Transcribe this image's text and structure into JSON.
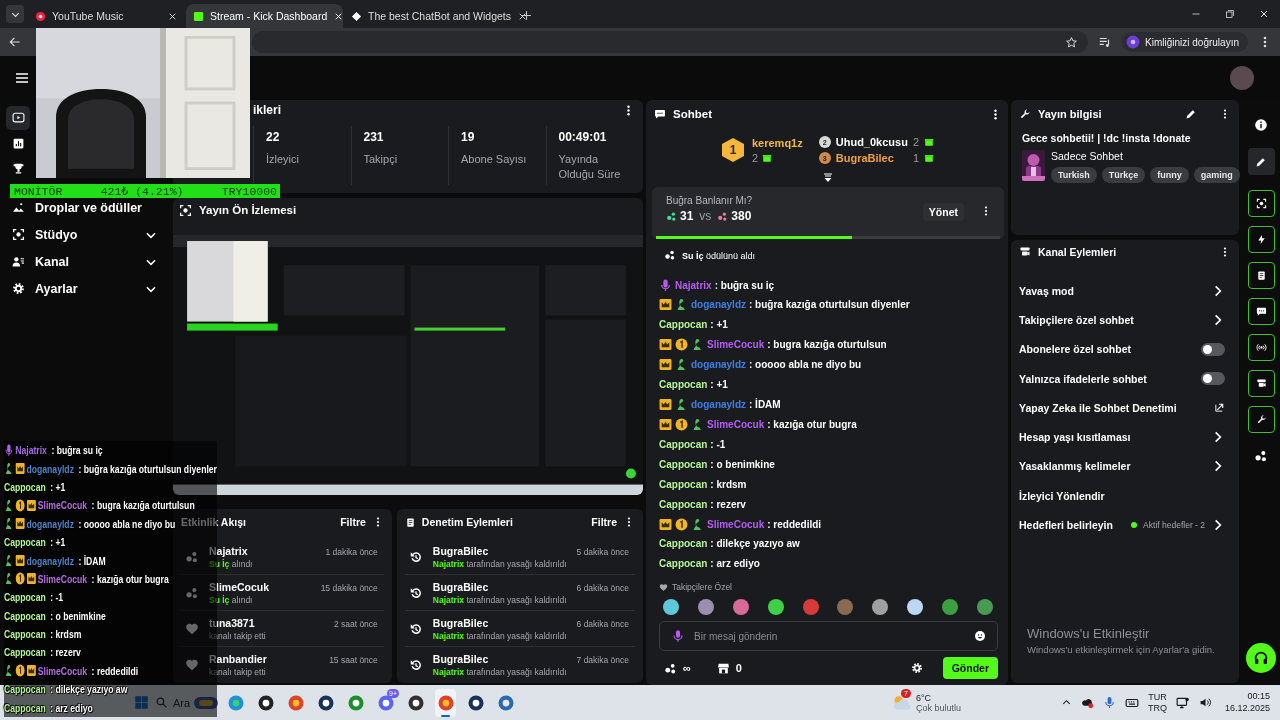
{
  "browser": {
    "tabs": [
      {
        "title": "YouTube Music",
        "selected": false
      },
      {
        "title": "Stream - Kick Dashboard",
        "selected": true
      },
      {
        "title": "The best ChatBot and Widgets",
        "selected": false
      }
    ],
    "verify": "Kimliğinizi doğrulayın"
  },
  "sidebar": {
    "icon_items": [
      {
        "selected": true
      },
      {
        "selected": false
      },
      {
        "selected": false
      }
    ],
    "items": [
      {
        "label": "Droplar ve ödüller",
        "expandable": false
      },
      {
        "label": "Stüdyo",
        "expandable": true
      },
      {
        "label": "Kanal",
        "expandable": true
      },
      {
        "label": "Ayarlar",
        "expandable": true
      }
    ]
  },
  "stats": {
    "title": "ikleri",
    "items": [
      {
        "value": "22",
        "label": "İzleyici"
      },
      {
        "value": "231",
        "label": "Takipçi"
      },
      {
        "value": "19",
        "label": "Abone Sayısı"
      },
      {
        "value": "00:49:01",
        "label": "Yayında Olduğu Süre"
      }
    ]
  },
  "preview": {
    "title": "Yayın Ön İzlemesi"
  },
  "ticker": {
    "label": "MONİTÖR",
    "change": "421₺ (4.21%)",
    "target": "TRY10000"
  },
  "events": {
    "title": "Etkinlik Akışı",
    "filter": "Filtre",
    "items": [
      {
        "kind": "reward",
        "user": "Najatrix",
        "highlight": "Su İç",
        "detail": "alındı",
        "time": "1 dakika önce"
      },
      {
        "kind": "reward",
        "user": "SlimeCocuk",
        "highlight": "Su İç",
        "detail": "alındı",
        "time": "15 dakika önce"
      },
      {
        "kind": "follow",
        "user": "tuna3871",
        "detail": "kanalı takip etti",
        "time": "2 saat önce"
      },
      {
        "kind": "follow",
        "user": "Ranbandier",
        "detail": "kanalı takip etti",
        "time": "15 saat önce"
      }
    ]
  },
  "moderation": {
    "title": "Denetim Eylemleri",
    "filter": "Filtre",
    "items": [
      {
        "kind": "unban",
        "user": "BugraBilec",
        "highlight": "Najatrix",
        "detail": "tarafından yasağı kaldırıldı",
        "time": "5 dakika önce"
      },
      {
        "kind": "unban",
        "user": "BugraBilec",
        "highlight": "Najatrix",
        "detail": "tarafından yasağı kaldırıldı",
        "time": "6 dakika önce"
      },
      {
        "kind": "unban",
        "user": "BugraBilec",
        "highlight": "Najatrix",
        "detail": "tarafından yasağı kaldırıldı",
        "time": "6 dakika önce"
      },
      {
        "kind": "unban",
        "user": "BugraBilec",
        "highlight": "Najatrix",
        "detail": "tarafından yasağı kaldırıldı",
        "time": "7 dakika önce"
      }
    ]
  },
  "chat": {
    "title": "Sohbet",
    "leaders": [
      {
        "rank": "1",
        "name": "keremq1z",
        "gifts": "2",
        "color": "#f5b83d"
      },
      {
        "rank": "2",
        "name": "Uhud_0kcusu",
        "gifts": "2",
        "color": "#ffffff"
      },
      {
        "rank": "3",
        "name": "BugraBilec",
        "gifts": "1",
        "color": "#f0a045"
      }
    ],
    "poll": {
      "question": "Buğra Banlanır Mı?",
      "votes_a": "31",
      "vs": "vs",
      "votes_b": "380",
      "manage": "Yönet",
      "level": 0.57
    },
    "pinned": "**Su İç** ödülünü aldı",
    "messages": [
      {
        "kind": "mic",
        "user": "Najatrix",
        "color": "#b65cf5",
        "text": ": buğra su iç"
      },
      {
        "kind": "crown",
        "user": "doganayldz",
        "color": "#3f7fe0",
        "text": ": buğra kazığa oturtulsun diyenler"
      },
      {
        "kind": "plain",
        "user": "Cappocan",
        "color": "#b4f59a",
        "text": ": +1"
      },
      {
        "kind": "gifter",
        "user": "SlimeCocuk",
        "color": "#b65cf5",
        "text": ": bugra kazığa oturtulsun"
      },
      {
        "kind": "crown",
        "user": "doganayldz",
        "color": "#3f7fe0",
        "text": ": ooooo abla ne diyo bu"
      },
      {
        "kind": "plain",
        "user": "Cappocan",
        "color": "#b4f59a",
        "text": ": +1"
      },
      {
        "kind": "crown",
        "user": "doganayldz",
        "color": "#3f7fe0",
        "text": ": İDAM"
      },
      {
        "kind": "gifter",
        "user": "SlimeCocuk",
        "color": "#b65cf5",
        "text": ": kazığa otur bugra"
      },
      {
        "kind": "plain",
        "user": "Cappocan",
        "color": "#b4f59a",
        "text": ": -1"
      },
      {
        "kind": "plain",
        "user": "Cappocan",
        "color": "#b4f59a",
        "text": ": o benimkine"
      },
      {
        "kind": "plain",
        "user": "Cappocan",
        "color": "#b4f59a",
        "text": ": krdsm"
      },
      {
        "kind": "plain",
        "user": "Cappocan",
        "color": "#b4f59a",
        "text": ": rezerv"
      },
      {
        "kind": "gifter",
        "user": "SlimeCocuk",
        "color": "#b65cf5",
        "text": ": reddedildi"
      },
      {
        "kind": "plain",
        "user": "Cappocan",
        "color": "#b4f59a",
        "text": ": dilekçe yazıyo aw"
      },
      {
        "kind": "plain",
        "user": "Cappocan",
        "color": "#b4f59a",
        "text": ": arz ediyo"
      }
    ],
    "followers_only": "Takipçilere Özel",
    "emotes": [
      {
        "color": "#5fc8d8"
      },
      {
        "color": "#9a8fb0"
      },
      {
        "color": "#d86a9a"
      },
      {
        "color": "#3fd04a"
      },
      {
        "color": "#d83a3a"
      },
      {
        "color": "#8a6a50"
      },
      {
        "color": "#a0a0a0"
      },
      {
        "color": "#bcd8f5"
      },
      {
        "color": "#3aa040"
      },
      {
        "color": "#4a9a55"
      }
    ],
    "placeholder": "Bir mesaj gönderin",
    "points": "∞",
    "store": "0",
    "send": "Gönder"
  },
  "info": {
    "title": "Yayın bilgisi",
    "stream_title": "Gece sohbetii! | !dc !insta !donate",
    "category": "Sadece Sohbet",
    "tags": [
      "Turkish",
      "Türkçe",
      "funny",
      "gaming"
    ]
  },
  "actions": {
    "title": "Kanal Eylemleri",
    "items": [
      {
        "kind": "link",
        "label": "Yavaş mod"
      },
      {
        "kind": "link",
        "label": "Takipçilere özel sohbet"
      },
      {
        "kind": "toggle",
        "label": "Abonelere özel sohbet",
        "on": false
      },
      {
        "kind": "toggle",
        "label": "Yalnızca ifadelerle sohbet",
        "on": false
      },
      {
        "kind": "external",
        "label": "Yapay Zeka ile Sohbet Denetimi"
      },
      {
        "kind": "link",
        "label": "Hesap yaşı kısıtlaması"
      },
      {
        "kind": "link",
        "label": "Yasaklanmış kelimeler"
      },
      {
        "kind": "plain",
        "label": "İzleyici Yönlendir"
      },
      {
        "kind": "goal",
        "label": "Hedefleri belirleyin",
        "status": "Aktif hedefler - 2"
      }
    ]
  },
  "rail": [
    {
      "kind": "plain"
    },
    {
      "kind": "active"
    },
    {
      "kind": "boxed"
    },
    {
      "kind": "boxed"
    },
    {
      "kind": "boxed"
    },
    {
      "kind": "boxed"
    },
    {
      "kind": "boxed"
    },
    {
      "kind": "boxed"
    },
    {
      "kind": "boxed"
    },
    {
      "kind": "plain"
    },
    {
      "kind": "support"
    }
  ],
  "windows_notice": {
    "title": "Windows'u Etkinleştir",
    "text": "Windows'u etkinleştirmek için Ayarlar'a gidin."
  },
  "overlay_chat": [
    {
      "kind": "mic",
      "user": "Najatrix",
      "color": "#a96ce6",
      "text": ": buğra su iç"
    },
    {
      "kind": "crown",
      "user": "doganayldz",
      "color": "#4f82c8",
      "text": ": buğra kazığa oturtulsun diyenler"
    },
    {
      "kind": "plain",
      "user": "Cappocan",
      "color": "#b4f59a",
      "text": ": +1"
    },
    {
      "kind": "gifter",
      "user": "SlimeCocuk",
      "color": "#b46ee0",
      "text": ": bugra kazığa oturtulsun"
    },
    {
      "kind": "crown",
      "user": "doganayldz",
      "color": "#4f82c8",
      "text": ": ooooo abla ne diyo bu"
    },
    {
      "kind": "plain",
      "user": "Cappocan",
      "color": "#b4f59a",
      "text": ": +1"
    },
    {
      "kind": "crown",
      "user": "doganayldz",
      "color": "#4f82c8",
      "text": ": İDAM"
    },
    {
      "kind": "gifter",
      "user": "SlimeCocuk",
      "color": "#b46ee0",
      "text": ": kazığa otur bugra"
    },
    {
      "kind": "plain",
      "user": "Cappocan",
      "color": "#b4f59a",
      "text": ": -1"
    },
    {
      "kind": "plain",
      "user": "Cappocan",
      "color": "#b4f59a",
      "text": ": o benimkine"
    },
    {
      "kind": "plain",
      "user": "Cappocan",
      "color": "#b4f59a",
      "text": ": krdsm"
    },
    {
      "kind": "plain",
      "user": "Cappocan",
      "color": "#b4f59a",
      "text": ": rezerv"
    },
    {
      "kind": "gifter",
      "user": "SlimeCocuk",
      "color": "#b46ee0",
      "text": ": reddedildi"
    },
    {
      "kind": "plain",
      "user": "Cappocan",
      "color": "#b4f59a",
      "text": ": dilekçe yazıyo aw"
    },
    {
      "kind": "plain",
      "user": "Cappocan",
      "color": "#b4f59a",
      "text": ": arz ediyo"
    }
  ],
  "taskbar": {
    "search": "Ara",
    "apps": [
      {
        "active": false
      },
      {
        "active": false
      },
      {
        "active": false
      },
      {
        "active": false
      },
      {
        "active": false
      },
      {
        "active": false
      },
      {
        "active": false,
        "badge": "9+"
      },
      {
        "active": false
      },
      {
        "active": true
      },
      {
        "active": false
      },
      {
        "active": false
      }
    ],
    "weather": {
      "badge": "7",
      "temp": "6°C",
      "desc": "Çok bulutlu"
    },
    "lang": "TUR",
    "layout": "TRQ",
    "time": "00:15",
    "date": "16.12.2025"
  }
}
